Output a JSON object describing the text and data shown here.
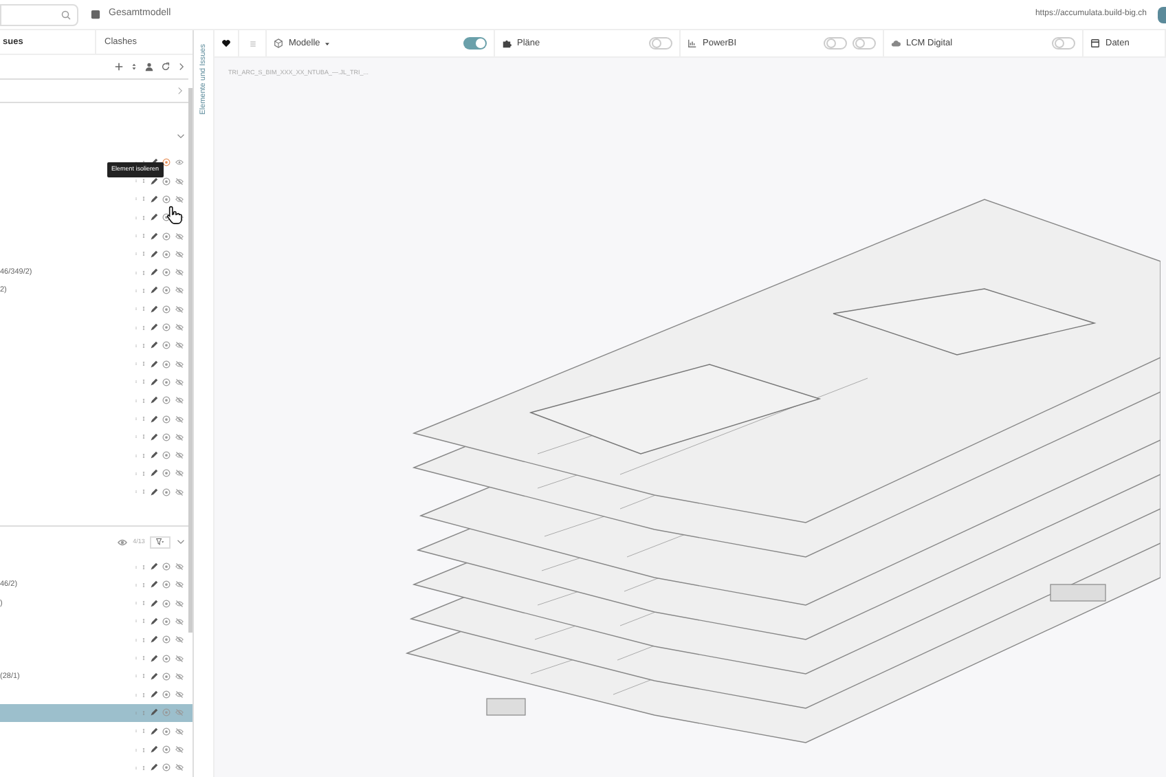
{
  "top_bar": {
    "model": "Gesamtmodell",
    "url": "https://accumulata.build-big.ch"
  },
  "panel_tabs": [
    {
      "label": "sues",
      "selected": true
    },
    {
      "label": "Clashes",
      "selected": false
    }
  ],
  "vertical_tab": "Elemente und Issues",
  "sections": [
    {
      "expanded": true,
      "rows": [
        {
          "text": "",
          "selected": false,
          "isolated": true,
          "hidden": false
        },
        {
          "text": "",
          "selected": false,
          "isolated": false,
          "hidden": true
        },
        {
          "text": "",
          "selected": false,
          "isolated": false,
          "hidden": true
        },
        {
          "text": "",
          "selected": false,
          "isolated": false,
          "hidden": true
        },
        {
          "text": "",
          "selected": false,
          "isolated": false,
          "hidden": true
        },
        {
          "text": "",
          "selected": false,
          "isolated": false,
          "hidden": true
        },
        {
          "text": "46/349/2)",
          "selected": false,
          "isolated": false,
          "hidden": true
        },
        {
          "text": "2)",
          "selected": false,
          "isolated": false,
          "hidden": true
        },
        {
          "text": "",
          "selected": false,
          "isolated": false,
          "hidden": true
        },
        {
          "text": "",
          "selected": false,
          "isolated": false,
          "hidden": true
        },
        {
          "text": "",
          "selected": false,
          "isolated": false,
          "hidden": true
        },
        {
          "text": "",
          "selected": false,
          "isolated": false,
          "hidden": true
        },
        {
          "text": "",
          "selected": false,
          "isolated": false,
          "hidden": true
        },
        {
          "text": "",
          "selected": false,
          "isolated": false,
          "hidden": true
        },
        {
          "text": "",
          "selected": false,
          "isolated": false,
          "hidden": true
        },
        {
          "text": "",
          "selected": false,
          "isolated": false,
          "hidden": true
        },
        {
          "text": "",
          "selected": false,
          "isolated": false,
          "hidden": true
        },
        {
          "text": "",
          "selected": false,
          "isolated": false,
          "hidden": true
        },
        {
          "text": "",
          "selected": false,
          "isolated": false,
          "hidden": true
        }
      ]
    },
    {
      "expanded": true,
      "count": "4/13",
      "rows": [
        {
          "text": "",
          "selected": false,
          "isolated": false,
          "hidden": true
        },
        {
          "text": "46/2)",
          "selected": false,
          "isolated": false,
          "hidden": true
        },
        {
          "text": ")",
          "selected": false,
          "isolated": false,
          "hidden": true
        },
        {
          "text": "",
          "selected": false,
          "isolated": false,
          "hidden": true
        },
        {
          "text": "",
          "selected": false,
          "isolated": false,
          "hidden": true
        },
        {
          "text": "",
          "selected": false,
          "isolated": false,
          "hidden": true
        },
        {
          "text": "(28/1)",
          "selected": false,
          "isolated": false,
          "hidden": true
        },
        {
          "text": "",
          "selected": false,
          "isolated": false,
          "hidden": true
        },
        {
          "text": "",
          "selected": true,
          "isolated": false,
          "hidden": true
        },
        {
          "text": "",
          "selected": false,
          "isolated": false,
          "hidden": true
        },
        {
          "text": "",
          "selected": false,
          "isolated": false,
          "hidden": true
        },
        {
          "text": "",
          "selected": false,
          "isolated": false,
          "hidden": true
        }
      ]
    }
  ],
  "tooltip": "Element isolieren",
  "toolbar": [
    {
      "kind": "heart"
    },
    {
      "kind": "list"
    },
    {
      "kind": "item",
      "label": "Modelle",
      "dropdown": true,
      "toggles": [
        {
          "on": true
        }
      ]
    },
    {
      "kind": "item",
      "label": "Pläne",
      "dropdown": false,
      "toggles": [
        {
          "on": false
        }
      ]
    },
    {
      "kind": "item",
      "label": "PowerBI",
      "dropdown": false,
      "toggles": [
        {
          "on": false
        },
        {
          "on": false
        }
      ]
    },
    {
      "kind": "item",
      "label": "LCM Digital",
      "dropdown": false,
      "toggles": [
        {
          "on": false
        }
      ]
    },
    {
      "kind": "item",
      "label": "Daten",
      "dropdown": false
    }
  ],
  "canvas": {
    "file_label": "TRI_ARC_S_BIM_XXX_XX_NTUBA_—.JL_TRI_..."
  }
}
